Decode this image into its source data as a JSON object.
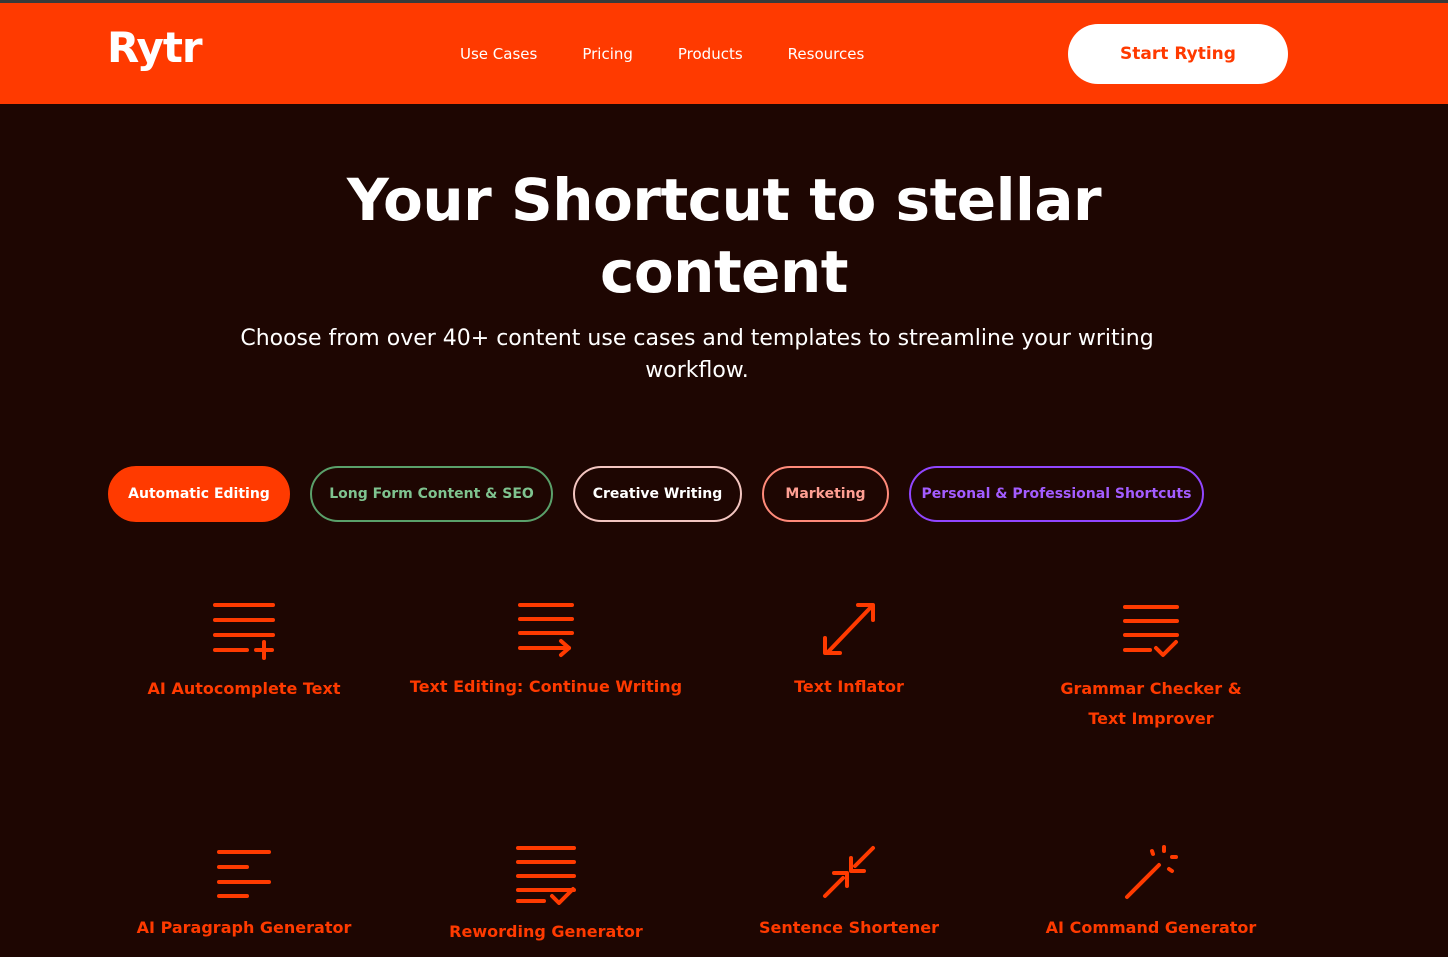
{
  "header": {
    "logo": "Rytr",
    "nav": [
      "Use Cases",
      "Pricing",
      "Products",
      "Resources"
    ],
    "cta": "Start Ryting"
  },
  "hero": {
    "title": "Your Shortcut to stellar content",
    "subtitle": "Choose from over 40+ content use cases and templates to streamline your writing workflow."
  },
  "tabs": [
    "Automatic Editing",
    "Long Form Content & SEO",
    "Creative Writing",
    "Marketing",
    "Personal & Professional Shortcuts"
  ],
  "cards": [
    {
      "label": "AI Autocomplete Text",
      "icon": "lines-plus-icon"
    },
    {
      "label": "Text Editing: Continue Writing",
      "icon": "lines-arrow-icon"
    },
    {
      "label": "Text Inflator",
      "icon": "expand-arrows-icon"
    },
    {
      "label": "Grammar Checker & Text Improver",
      "icon": "lines-check-icon"
    },
    {
      "label": "AI Paragraph Generator",
      "icon": "paragraph-lines-icon"
    },
    {
      "label": "Rewording Generator",
      "icon": "lines-check-icon"
    },
    {
      "label": "Sentence Shortener",
      "icon": "compress-arrows-icon"
    },
    {
      "label": "AI Command Generator",
      "icon": "magic-wand-icon"
    }
  ],
  "colors": {
    "brand": "#ff3a00",
    "background": "#1e0602"
  }
}
